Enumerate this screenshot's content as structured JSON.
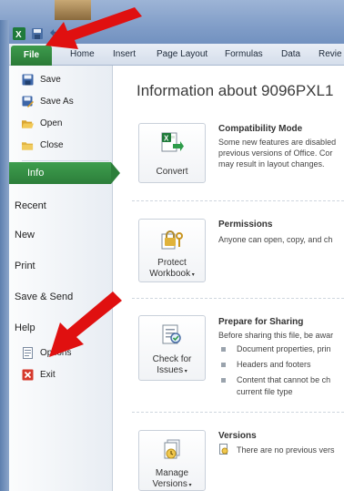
{
  "ribbon": {
    "file_tab": "File",
    "tabs": [
      "Home",
      "Insert",
      "Page Layout",
      "Formulas",
      "Data",
      "Revie"
    ]
  },
  "backstage": {
    "commands": [
      {
        "label": "Save",
        "icon": "save-icon"
      },
      {
        "label": "Save As",
        "icon": "save-as-icon"
      },
      {
        "label": "Open",
        "icon": "open-folder-icon"
      },
      {
        "label": "Close",
        "icon": "close-folder-icon"
      }
    ],
    "nav": {
      "info": "Info",
      "recent": "Recent",
      "new": "New",
      "print": "Print",
      "save_send": "Save & Send",
      "help": "Help"
    },
    "bottom_commands": [
      {
        "label": "Options",
        "icon": "options-icon"
      },
      {
        "label": "Exit",
        "icon": "exit-icon"
      }
    ]
  },
  "info": {
    "title": "Information about 9096PXL1",
    "sections": [
      {
        "button": "Convert",
        "title": "Compatibility Mode",
        "lines": [
          "Some new features are disabled",
          "previous versions of Office. Cor",
          "may result in layout changes."
        ]
      },
      {
        "button_line1": "Protect",
        "button_line2": "Workbook",
        "title": "Permissions",
        "lines": [
          "Anyone can open, copy, and ch"
        ]
      },
      {
        "button_line1": "Check for",
        "button_line2": "Issues",
        "title": "Prepare for Sharing",
        "lines": [
          "Before sharing this file, be awar"
        ],
        "bullets": [
          "Document properties, prin",
          "Headers and footers",
          "Content that cannot be ch",
          "current file type"
        ]
      },
      {
        "button_line1": "Manage",
        "button_line2": "Versions",
        "title": "Versions",
        "lines": [
          "There are no previous vers"
        ]
      }
    ]
  },
  "colors": {
    "accent_green": "#2c7e3a",
    "arrow_red": "#e01010"
  }
}
